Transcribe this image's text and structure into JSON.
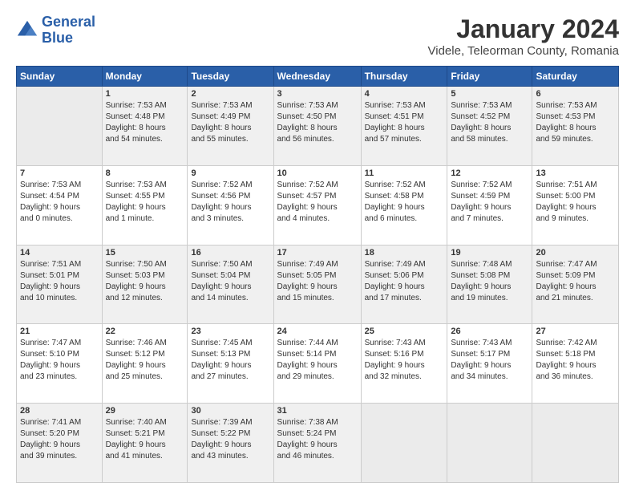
{
  "header": {
    "logo_line1": "General",
    "logo_line2": "Blue",
    "month": "January 2024",
    "location": "Videle, Teleorman County, Romania"
  },
  "weekdays": [
    "Sunday",
    "Monday",
    "Tuesday",
    "Wednesday",
    "Thursday",
    "Friday",
    "Saturday"
  ],
  "weeks": [
    [
      {
        "day": "",
        "info": ""
      },
      {
        "day": "1",
        "info": "Sunrise: 7:53 AM\nSunset: 4:48 PM\nDaylight: 8 hours\nand 54 minutes."
      },
      {
        "day": "2",
        "info": "Sunrise: 7:53 AM\nSunset: 4:49 PM\nDaylight: 8 hours\nand 55 minutes."
      },
      {
        "day": "3",
        "info": "Sunrise: 7:53 AM\nSunset: 4:50 PM\nDaylight: 8 hours\nand 56 minutes."
      },
      {
        "day": "4",
        "info": "Sunrise: 7:53 AM\nSunset: 4:51 PM\nDaylight: 8 hours\nand 57 minutes."
      },
      {
        "day": "5",
        "info": "Sunrise: 7:53 AM\nSunset: 4:52 PM\nDaylight: 8 hours\nand 58 minutes."
      },
      {
        "day": "6",
        "info": "Sunrise: 7:53 AM\nSunset: 4:53 PM\nDaylight: 8 hours\nand 59 minutes."
      }
    ],
    [
      {
        "day": "7",
        "info": "Sunrise: 7:53 AM\nSunset: 4:54 PM\nDaylight: 9 hours\nand 0 minutes."
      },
      {
        "day": "8",
        "info": "Sunrise: 7:53 AM\nSunset: 4:55 PM\nDaylight: 9 hours\nand 1 minute."
      },
      {
        "day": "9",
        "info": "Sunrise: 7:52 AM\nSunset: 4:56 PM\nDaylight: 9 hours\nand 3 minutes."
      },
      {
        "day": "10",
        "info": "Sunrise: 7:52 AM\nSunset: 4:57 PM\nDaylight: 9 hours\nand 4 minutes."
      },
      {
        "day": "11",
        "info": "Sunrise: 7:52 AM\nSunset: 4:58 PM\nDaylight: 9 hours\nand 6 minutes."
      },
      {
        "day": "12",
        "info": "Sunrise: 7:52 AM\nSunset: 4:59 PM\nDaylight: 9 hours\nand 7 minutes."
      },
      {
        "day": "13",
        "info": "Sunrise: 7:51 AM\nSunset: 5:00 PM\nDaylight: 9 hours\nand 9 minutes."
      }
    ],
    [
      {
        "day": "14",
        "info": "Sunrise: 7:51 AM\nSunset: 5:01 PM\nDaylight: 9 hours\nand 10 minutes."
      },
      {
        "day": "15",
        "info": "Sunrise: 7:50 AM\nSunset: 5:03 PM\nDaylight: 9 hours\nand 12 minutes."
      },
      {
        "day": "16",
        "info": "Sunrise: 7:50 AM\nSunset: 5:04 PM\nDaylight: 9 hours\nand 14 minutes."
      },
      {
        "day": "17",
        "info": "Sunrise: 7:49 AM\nSunset: 5:05 PM\nDaylight: 9 hours\nand 15 minutes."
      },
      {
        "day": "18",
        "info": "Sunrise: 7:49 AM\nSunset: 5:06 PM\nDaylight: 9 hours\nand 17 minutes."
      },
      {
        "day": "19",
        "info": "Sunrise: 7:48 AM\nSunset: 5:08 PM\nDaylight: 9 hours\nand 19 minutes."
      },
      {
        "day": "20",
        "info": "Sunrise: 7:47 AM\nSunset: 5:09 PM\nDaylight: 9 hours\nand 21 minutes."
      }
    ],
    [
      {
        "day": "21",
        "info": "Sunrise: 7:47 AM\nSunset: 5:10 PM\nDaylight: 9 hours\nand 23 minutes."
      },
      {
        "day": "22",
        "info": "Sunrise: 7:46 AM\nSunset: 5:12 PM\nDaylight: 9 hours\nand 25 minutes."
      },
      {
        "day": "23",
        "info": "Sunrise: 7:45 AM\nSunset: 5:13 PM\nDaylight: 9 hours\nand 27 minutes."
      },
      {
        "day": "24",
        "info": "Sunrise: 7:44 AM\nSunset: 5:14 PM\nDaylight: 9 hours\nand 29 minutes."
      },
      {
        "day": "25",
        "info": "Sunrise: 7:43 AM\nSunset: 5:16 PM\nDaylight: 9 hours\nand 32 minutes."
      },
      {
        "day": "26",
        "info": "Sunrise: 7:43 AM\nSunset: 5:17 PM\nDaylight: 9 hours\nand 34 minutes."
      },
      {
        "day": "27",
        "info": "Sunrise: 7:42 AM\nSunset: 5:18 PM\nDaylight: 9 hours\nand 36 minutes."
      }
    ],
    [
      {
        "day": "28",
        "info": "Sunrise: 7:41 AM\nSunset: 5:20 PM\nDaylight: 9 hours\nand 39 minutes."
      },
      {
        "day": "29",
        "info": "Sunrise: 7:40 AM\nSunset: 5:21 PM\nDaylight: 9 hours\nand 41 minutes."
      },
      {
        "day": "30",
        "info": "Sunrise: 7:39 AM\nSunset: 5:22 PM\nDaylight: 9 hours\nand 43 minutes."
      },
      {
        "day": "31",
        "info": "Sunrise: 7:38 AM\nSunset: 5:24 PM\nDaylight: 9 hours\nand 46 minutes."
      },
      {
        "day": "",
        "info": ""
      },
      {
        "day": "",
        "info": ""
      },
      {
        "day": "",
        "info": ""
      }
    ]
  ]
}
